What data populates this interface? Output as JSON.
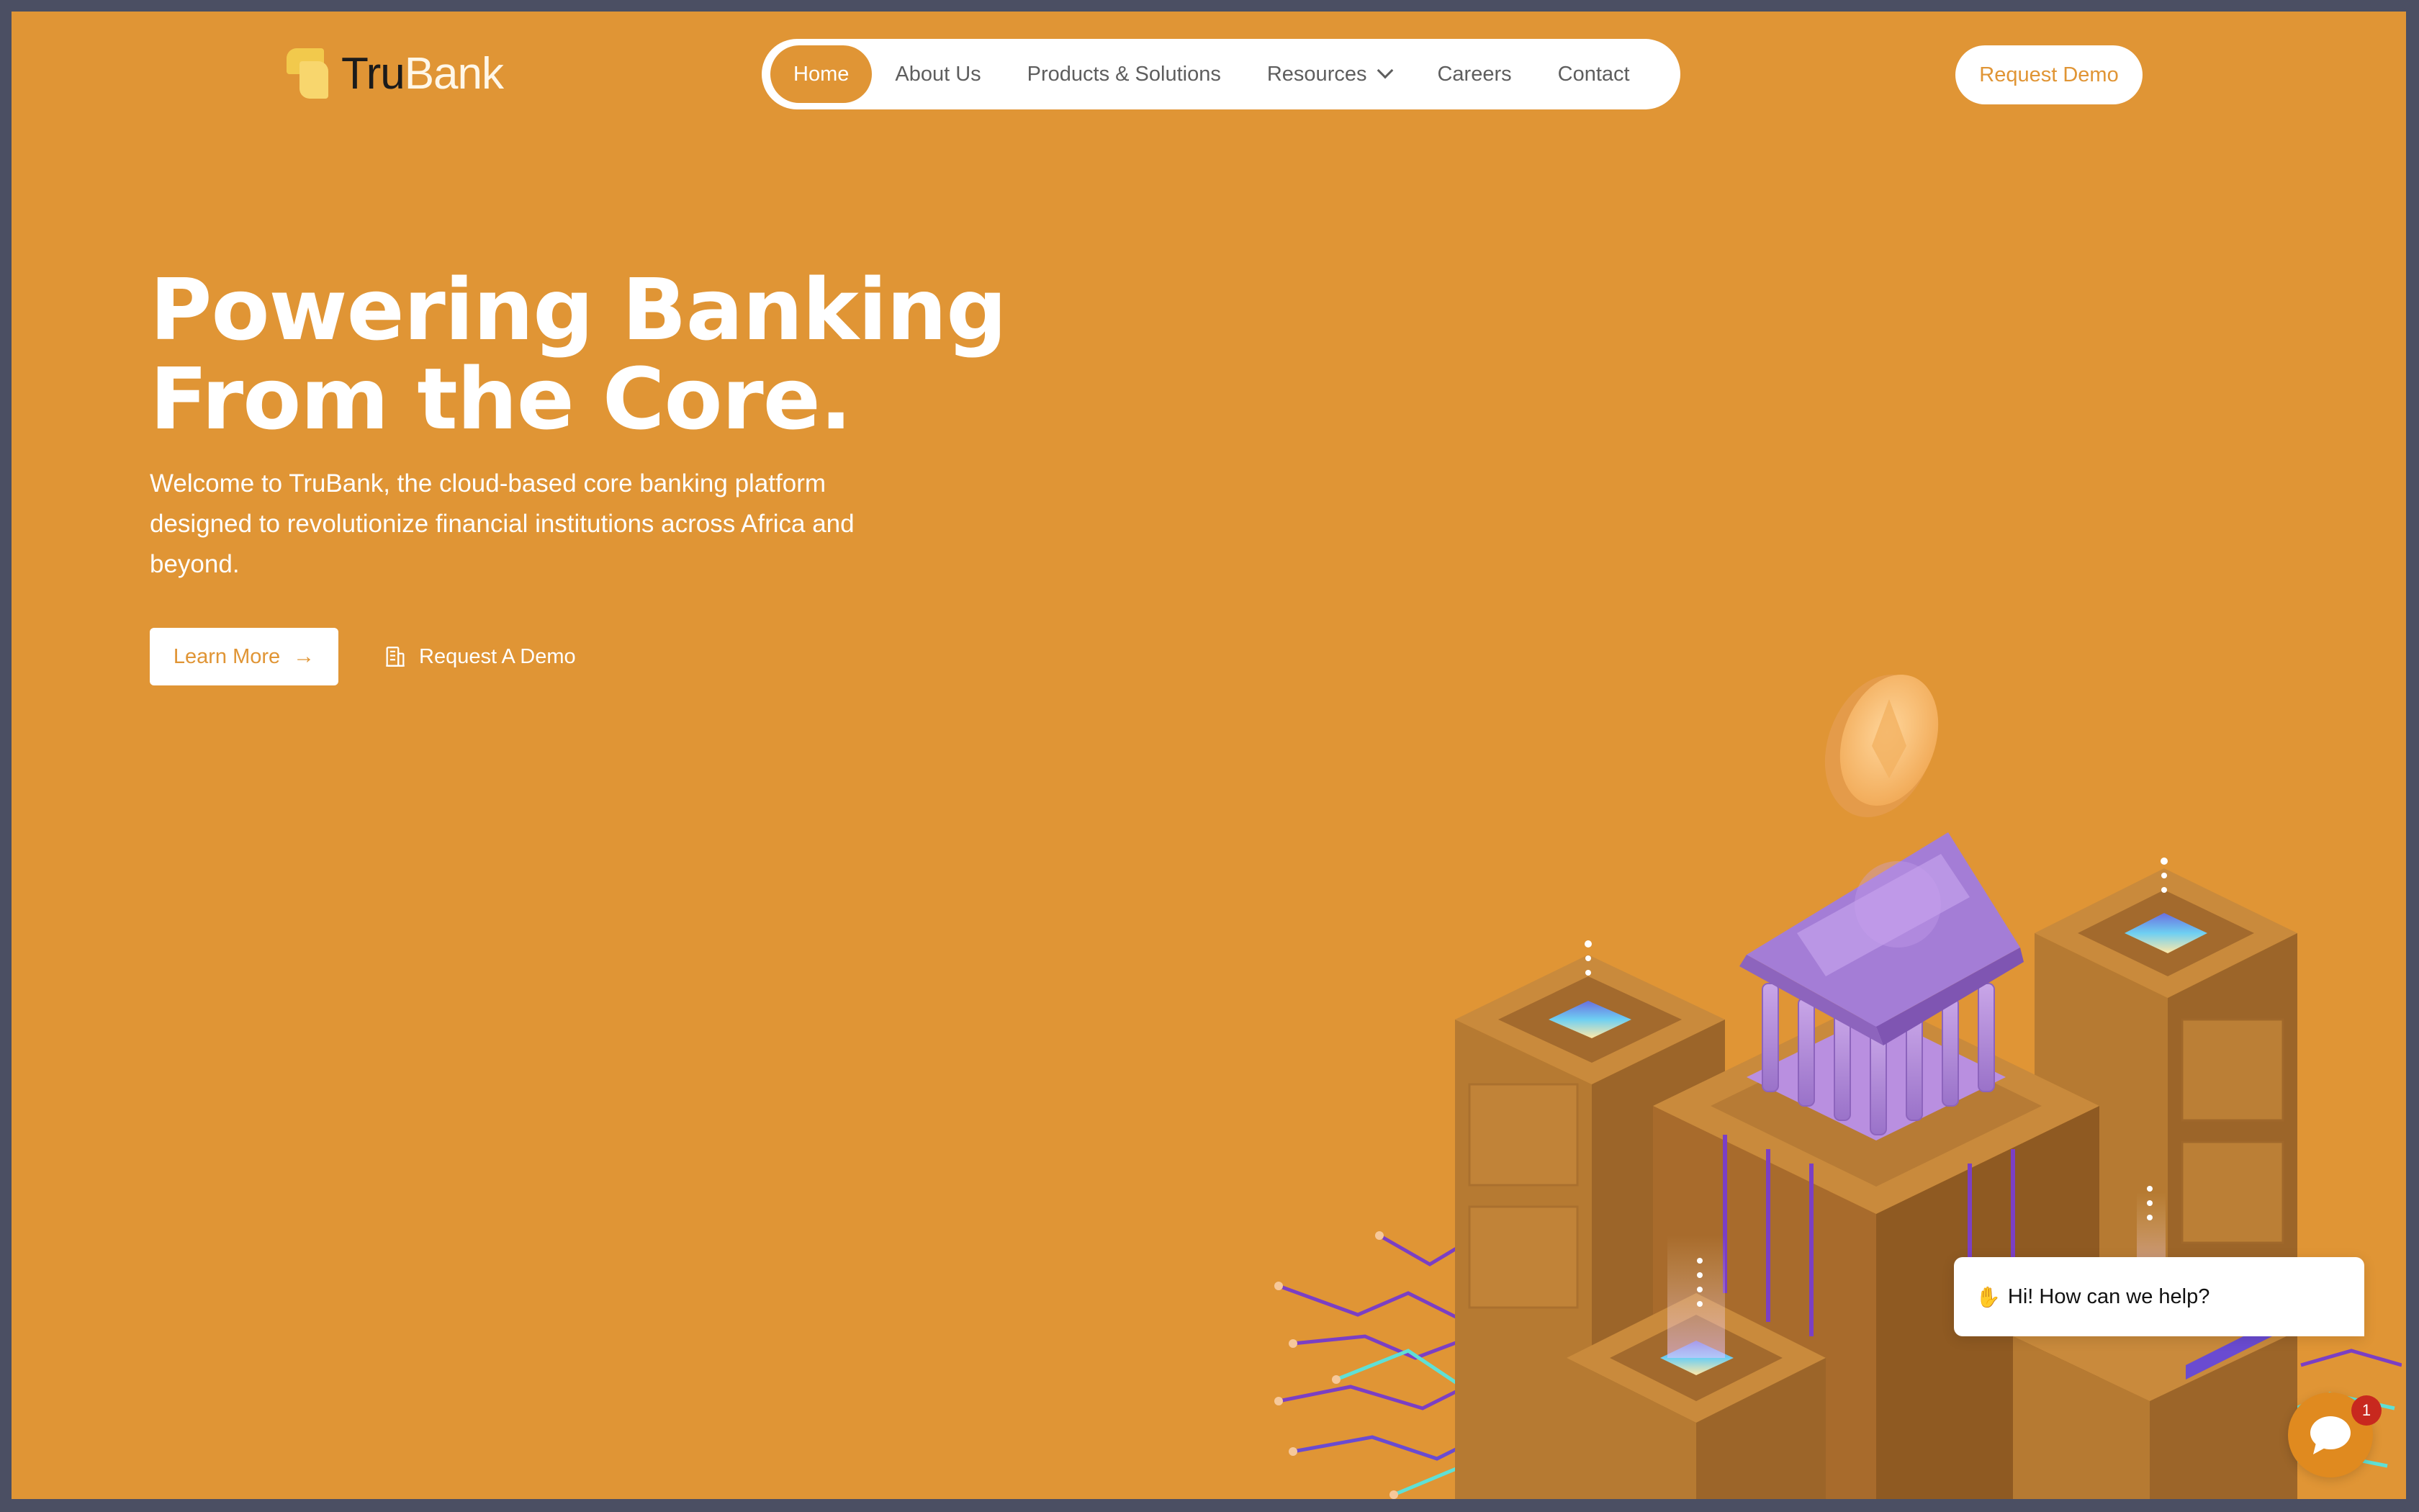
{
  "brand": {
    "name_part1": "Tru",
    "name_part2": "Bank"
  },
  "nav": {
    "items": [
      {
        "label": "Home"
      },
      {
        "label": "About Us"
      },
      {
        "label": "Products & Solutions"
      },
      {
        "label": "Resources"
      },
      {
        "label": "Careers"
      },
      {
        "label": "Contact"
      }
    ],
    "active": "Home"
  },
  "header": {
    "cta_label": "Request Demo"
  },
  "hero": {
    "title_line1": "Powering Banking",
    "title_line2": "From the Core.",
    "subtitle": "Welcome to TruBank, the cloud-based core banking platform designed to revolutionize financial institutions across Africa and beyond.",
    "primary_label": "Learn More",
    "secondary_label": "Request A Demo"
  },
  "chat": {
    "greeting": "Hi! How can we help?",
    "unread_count": "1"
  },
  "colors": {
    "background": "#e09535",
    "accent": "#e09535",
    "white": "#ffffff",
    "badge": "#c8281e"
  },
  "icons": [
    "arrow-right-icon",
    "building-icon",
    "chevron-down-icon",
    "chat-icon",
    "wave-hand-icon"
  ]
}
